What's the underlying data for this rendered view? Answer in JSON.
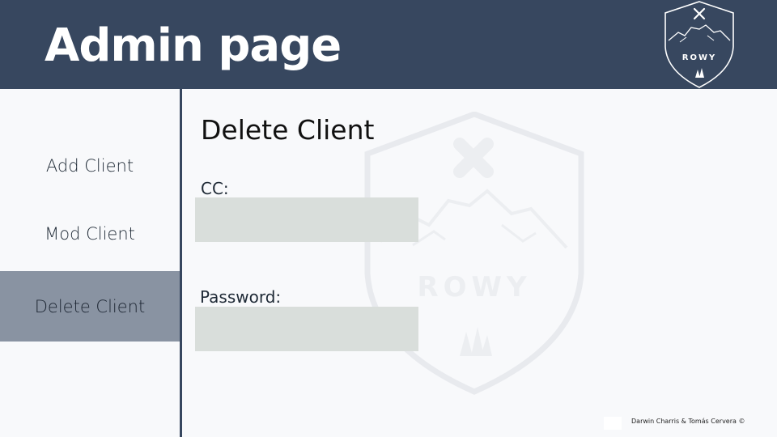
{
  "header": {
    "title": "Admin page",
    "logo_text": "ROWY",
    "background": "#37475f"
  },
  "sidebar": {
    "items": [
      {
        "label": "Add Client",
        "active": false
      },
      {
        "label": "Mod Client",
        "active": false
      },
      {
        "label": "Delete Client",
        "active": true
      }
    ],
    "active_color": "#8993a2"
  },
  "main": {
    "title": "Delete Client",
    "fields": [
      {
        "label": "CC:",
        "value": "",
        "placeholder": ""
      },
      {
        "label": "Password:",
        "value": "",
        "placeholder": ""
      }
    ],
    "field_color": "#d9dedb",
    "watermark_text": "ROWY"
  },
  "footer": {
    "credit": "Darwin Charris & Tomás Cervera ©"
  },
  "icons": {
    "logo": "rowy-shield-logo-icon",
    "watermark": "rowy-shield-watermark-icon"
  }
}
